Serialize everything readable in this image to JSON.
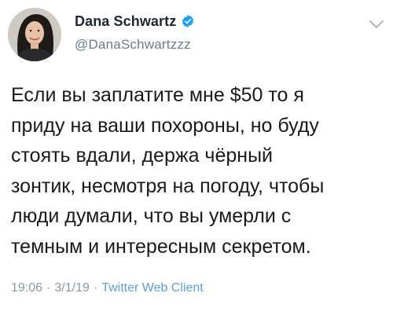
{
  "author": {
    "display_name": "Dana Schwartz",
    "handle": "@DanaSchwartzzz",
    "verified": true
  },
  "icons": {
    "verified": "verified-badge-icon",
    "menu": "chevron-down-icon"
  },
  "tweet": {
    "text_lines": [
      "Если вы заплатите мне $50 то я",
      "приду на ваши похороны, но буду",
      "стоять вдали, держа чёрный",
      "зонтик, несмотря на погоду, чтобы",
      "люди думали, что вы умерли с",
      "темным и интересным секретом."
    ],
    "time": "19:06",
    "separator": "·",
    "date": "3/1/19",
    "client": "Twitter Web Client"
  },
  "colors": {
    "verified_blue": "#1da1f2",
    "meta_gray": "#8899a6",
    "client_blue": "#5c9ed6"
  }
}
